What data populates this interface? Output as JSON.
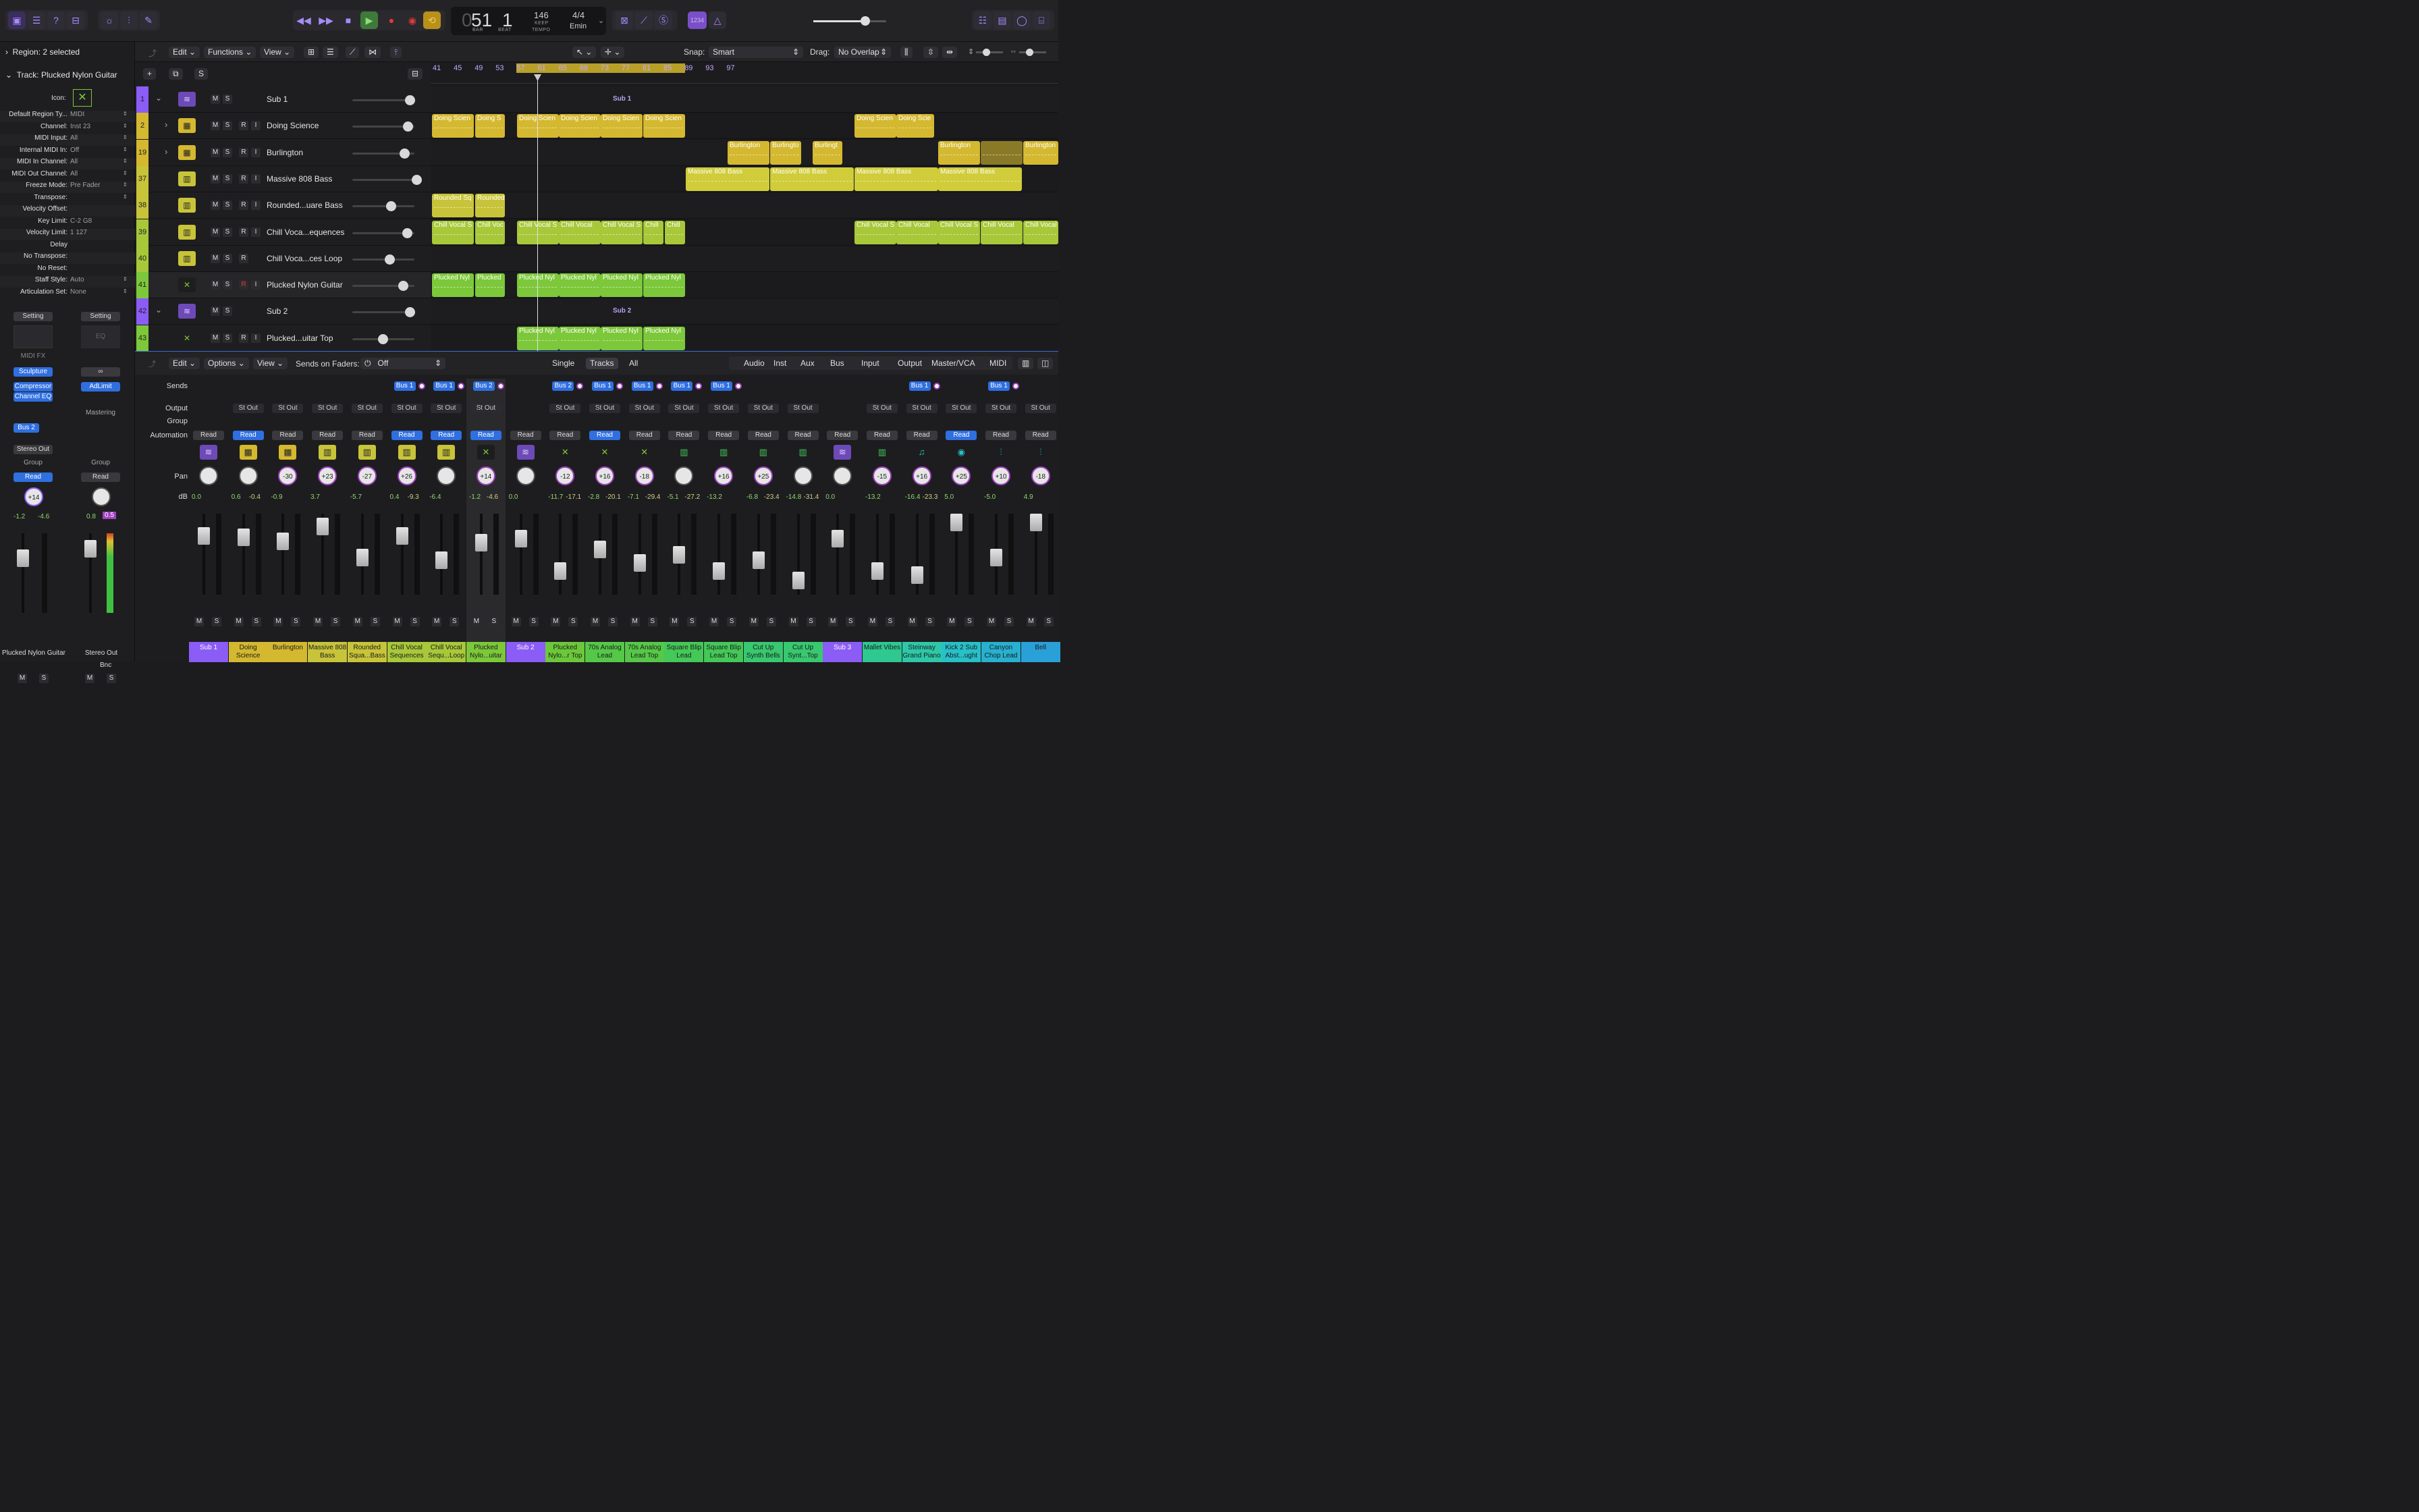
{
  "transport": {
    "bar": "51",
    "beat": "1",
    "bar_label": "BAR",
    "beat_label": "BEAT",
    "tempo": "146",
    "tempo_mode": "KEEP",
    "tempo_label": "TEMPO",
    "signature": "4/4",
    "key": "Emin",
    "lcd_zero": "0"
  },
  "inspector": {
    "region_header": "Region: 2 selected",
    "track_header": "Track:  Plucked Nylon Guitar",
    "icon_label": "Icon:",
    "rows": [
      {
        "k": "Default Region Ty...",
        "v": "MIDI",
        "ud": true
      },
      {
        "k": "Channel:",
        "v": "Inst 23",
        "ud": true
      },
      {
        "k": "MIDI Input:",
        "v": "All",
        "ud": true
      },
      {
        "k": "Internal MIDI In:",
        "v": "Off",
        "ud": true
      },
      {
        "k": "MIDI In Channel:",
        "v": "All",
        "ud": true
      },
      {
        "k": "MIDI Out Channel:",
        "v": "All",
        "ud": true
      },
      {
        "k": "Freeze Mode:",
        "v": "Pre Fader",
        "ud": true
      },
      {
        "k": "Transpose:",
        "v": "",
        "ud": true
      },
      {
        "k": "Velocity Offset:",
        "v": "",
        "ud": false
      },
      {
        "k": "Key Limit:",
        "v": "C-2  G8",
        "ud": false
      },
      {
        "k": "Velocity Limit:",
        "v": "1  127",
        "ud": false
      },
      {
        "k": "Delay",
        "v": "",
        "ud": false
      },
      {
        "k": "No Transpose:",
        "v": "",
        "ud": false
      },
      {
        "k": "No Reset:",
        "v": "",
        "ud": false
      },
      {
        "k": "Staff Style:",
        "v": "Auto",
        "ud": true
      },
      {
        "k": "Articulation Set:",
        "v": "None",
        "ud": true
      }
    ],
    "strip1": {
      "setting": "Setting",
      "midifx": "MIDI FX",
      "plugins": [
        "Sculpture",
        "Compressor",
        "Channel EQ"
      ],
      "send": "Bus 2",
      "output": "Stereo Out",
      "group": "Group",
      "auto": "Read",
      "pan": "+14",
      "db1": "-1.2",
      "db2": "-4.6",
      "name": "Plucked Nylon Guitar",
      "m": "M",
      "s": "S"
    },
    "strip2": {
      "setting": "Setting",
      "eq": "EQ",
      "plugins": [
        "AdLimit"
      ],
      "mastering": "Mastering",
      "group": "Group",
      "auto": "Read",
      "db1": "0.8",
      "db2": "0.5",
      "bnc": "Bnc",
      "name": "Stereo Out",
      "m": "M",
      "s": "S"
    }
  },
  "arrange_toolbar": {
    "edit": "Edit",
    "functions": "Functions",
    "view": "View",
    "snap_label": "Snap:",
    "snap": "Smart",
    "drag_label": "Drag:",
    "drag": "No Overlap"
  },
  "track_tools": {
    "add": "+",
    "s": "S"
  },
  "tracks": [
    {
      "num": "1",
      "name": "Sub 1",
      "type": "sub",
      "rec": false,
      "knob": 78
    },
    {
      "num": "2",
      "name": "Doing Science",
      "type": "drum",
      "rec": true,
      "knob": 75,
      "expand": true
    },
    {
      "num": "19",
      "name": "Burlington",
      "type": "drum",
      "rec": true,
      "knob": 70,
      "expand": true
    },
    {
      "num": "37",
      "name": "Massive 808 Bass",
      "type": "synth",
      "rec": true,
      "knob": 88
    },
    {
      "num": "38",
      "name": "Rounded...uare Bass",
      "type": "synth",
      "rec": true,
      "knob": 50
    },
    {
      "num": "39",
      "name": "Chill Voca...equences",
      "type": "synth",
      "rec": true,
      "knob": 74
    },
    {
      "num": "40",
      "name": "Chill Voca...ces Loop",
      "type": "synth",
      "rec": false,
      "knob": 48
    },
    {
      "num": "41",
      "name": "Plucked Nylon Guitar",
      "type": "guitar",
      "rec": true,
      "knob": 68,
      "armed": true
    },
    {
      "num": "42",
      "name": "Sub 2",
      "type": "sub",
      "rec": false,
      "knob": 78
    },
    {
      "num": "43",
      "name": "Plucked...uitar Top",
      "type": "guitar",
      "rec": true,
      "knob": 38
    }
  ],
  "ruler": [
    "41",
    "45",
    "49",
    "53",
    "57",
    "61",
    "65",
    "69",
    "73",
    "77",
    "81",
    "85",
    "89",
    "93",
    "97"
  ],
  "regions": {
    "sub1": "Sub 1",
    "sub2": "Sub 2",
    "doing": "Doing Scien",
    "doings": "Doing S",
    "doingscie": "Doing Scie",
    "burl": "Burlington",
    "burl2": "Burlingto",
    "burl3": "Burlingt",
    "mass": "Massive 808 Bass",
    "round": "Rounded Sq",
    "round2": "Rounded",
    "chill": "Chill Vocal S",
    "chill2": "Chill Voc",
    "chill3": "Chill Vocal",
    "chill4": "Chill",
    "pluck": "Plucked Nyl",
    "pluck2": "Plucked"
  },
  "mixer_toolbar": {
    "edit": "Edit",
    "options": "Options",
    "view": "View",
    "sends_on_faders": "Sends on Faders:",
    "off": "Off",
    "single": "Single",
    "tracks": "Tracks",
    "all": "All",
    "filters": [
      "Audio",
      "Inst",
      "Aux",
      "Bus",
      "Input",
      "Output",
      "Master/VCA",
      "MIDI"
    ]
  },
  "mixer_labels": {
    "sends": "Sends",
    "output": "Output",
    "group": "Group",
    "automation": "Automation",
    "pan": "Pan",
    "db": "dB"
  },
  "strips": [
    {
      "name": "Sub 1",
      "color": "#8b5cf6",
      "send": "",
      "out": "",
      "auto": "Read",
      "autoblue": false,
      "pan": "",
      "db1": "0.0",
      "db2": "",
      "ico": "sub"
    },
    {
      "name": "Doing Science",
      "color": "#d4b830",
      "send": "",
      "out": "St Out",
      "auto": "Read",
      "autoblue": true,
      "pan": "",
      "db1": "0.6",
      "db2": "-0.4",
      "ico": "drum"
    },
    {
      "name": "Burlington",
      "color": "#d4b830",
      "send": "",
      "out": "St Out",
      "auto": "Read",
      "autoblue": false,
      "pan": "-30",
      "db1": "-0.9",
      "db2": "",
      "ico": "drum"
    },
    {
      "name": "Massive 808 Bass",
      "color": "#c8c43a",
      "send": "",
      "out": "St Out",
      "auto": "Read",
      "autoblue": false,
      "pan": "+23",
      "db1": "3.7",
      "db2": "",
      "ico": "synth"
    },
    {
      "name": "Rounded Squa...Bass",
      "color": "#c8c43a",
      "send": "",
      "out": "St Out",
      "auto": "Read",
      "autoblue": false,
      "pan": "-27",
      "db1": "-5.7",
      "db2": "",
      "ico": "synth"
    },
    {
      "name": "Chill Vocal Sequences",
      "color": "#a8c83a",
      "send": "Bus 1",
      "out": "St Out",
      "auto": "Read",
      "autoblue": true,
      "pan": "+26",
      "db1": "0.4",
      "db2": "-9.3",
      "ico": "synth"
    },
    {
      "name": "Chill Vocal Sequ...Loop",
      "color": "#a8c83a",
      "send": "Bus 1",
      "out": "St Out",
      "auto": "Read",
      "autoblue": true,
      "pan": "",
      "db1": "-6.4",
      "db2": "",
      "ico": "synth"
    },
    {
      "name": "Plucked Nylo...uitar",
      "color": "#7cc83a",
      "send": "Bus 2",
      "out": "St Out",
      "auto": "Read",
      "autoblue": true,
      "pan": "+14",
      "db1": "-1.2",
      "db2": "-4.6",
      "ico": "guitar",
      "sel": true
    },
    {
      "name": "Sub 2",
      "color": "#8b5cf6",
      "send": "",
      "out": "",
      "auto": "Read",
      "autoblue": false,
      "pan": "",
      "db1": "0.0",
      "db2": "",
      "ico": "sub"
    },
    {
      "name": "Plucked Nylo...r Top",
      "color": "#6cc83a",
      "send": "Bus 2",
      "out": "St Out",
      "auto": "Read",
      "autoblue": false,
      "pan": "-12",
      "db1": "-11.7",
      "db2": "-17.1",
      "ico": "guitar"
    },
    {
      "name": "70s Analog Lead",
      "color": "#56c848",
      "send": "Bus 1",
      "out": "St Out",
      "auto": "Read",
      "autoblue": true,
      "pan": "+16",
      "db1": "-2.8",
      "db2": "-20.1",
      "ico": "guitar"
    },
    {
      "name": "70s Analog Lead Top",
      "color": "#56c848",
      "send": "Bus 1",
      "out": "St Out",
      "auto": "Read",
      "autoblue": false,
      "pan": "-18",
      "db1": "-7.1",
      "db2": "-29.4",
      "ico": "guitar"
    },
    {
      "name": "Square Blip Lead",
      "color": "#44c858",
      "send": "Bus 1",
      "out": "St Out",
      "auto": "Read",
      "autoblue": false,
      "pan": "",
      "db1": "-5.1",
      "db2": "-27.2",
      "ico": "keys"
    },
    {
      "name": "Square Blip Lead Top",
      "color": "#44c858",
      "send": "Bus 1",
      "out": "St Out",
      "auto": "Read",
      "autoblue": false,
      "pan": "+16",
      "db1": "-13.2",
      "db2": "",
      "ico": "keys"
    },
    {
      "name": "Cut Up Synth Bells",
      "color": "#38c870",
      "send": "",
      "out": "St Out",
      "auto": "Read",
      "autoblue": false,
      "pan": "+25",
      "db1": "-6.8",
      "db2": "-23.4",
      "ico": "keys"
    },
    {
      "name": "Cut Up Synt...Top",
      "color": "#38c870",
      "send": "",
      "out": "St Out",
      "auto": "Read",
      "autoblue": false,
      "pan": "",
      "db1": "-14.8",
      "db2": "-31.4",
      "ico": "keys"
    },
    {
      "name": "Sub 3",
      "color": "#8b5cf6",
      "send": "",
      "out": "",
      "auto": "Read",
      "autoblue": false,
      "pan": "",
      "db1": "0.0",
      "db2": "",
      "ico": "sub"
    },
    {
      "name": "Mallet Vibes",
      "color": "#2ec890",
      "send": "",
      "out": "St Out",
      "auto": "Read",
      "autoblue": false,
      "pan": "-15",
      "db1": "-13.2",
      "db2": "",
      "ico": "keys"
    },
    {
      "name": "Steinway Grand Piano",
      "color": "#2ec8a8",
      "send": "Bus 1",
      "out": "St Out",
      "auto": "Read",
      "autoblue": false,
      "pan": "+16",
      "db1": "-16.4",
      "db2": "-23.3",
      "ico": "piano"
    },
    {
      "name": "Kick 2 Sub Abst...ught",
      "color": "#28c0c8",
      "send": "",
      "out": "St Out",
      "auto": "Read",
      "autoblue": true,
      "pan": "+25",
      "db1": "5.0",
      "db2": "",
      "ico": "drumkit"
    },
    {
      "name": "Canyon Chop Lead",
      "color": "#28b0d0",
      "send": "Bus 1",
      "out": "St Out",
      "auto": "Read",
      "autoblue": false,
      "pan": "+10",
      "db1": "-5.0",
      "db2": "",
      "ico": "wave"
    },
    {
      "name": "Bell",
      "color": "#2aa0d8",
      "send": "",
      "out": "St Out",
      "auto": "Read",
      "autoblue": false,
      "pan": "-18",
      "db1": "4.9",
      "db2": "",
      "ico": "wave"
    }
  ],
  "ms": {
    "m": "M",
    "s": "S",
    "r": "R",
    "i": "I"
  },
  "colors": {
    "accent": "#a78bfa",
    "blue": "#2f6fe0",
    "green": "#4caf50"
  }
}
